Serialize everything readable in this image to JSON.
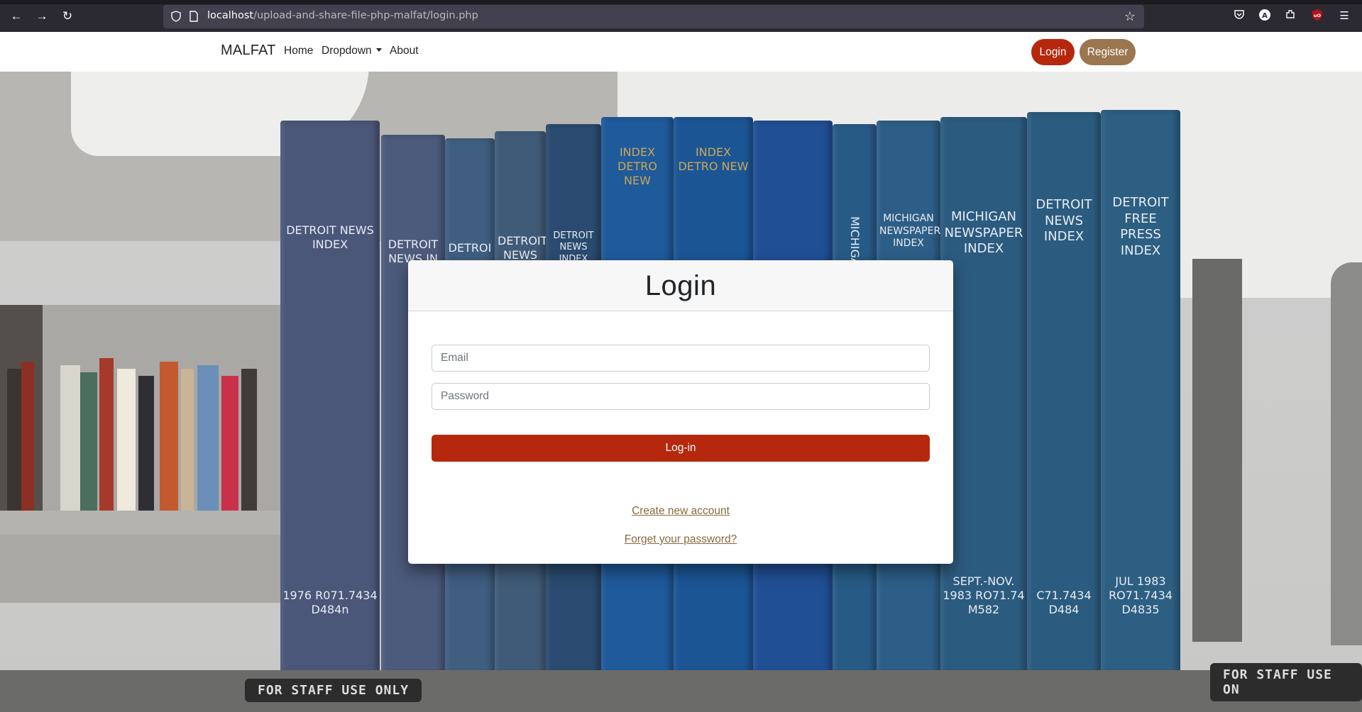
{
  "browser": {
    "url_host": "localhost",
    "url_path": "/upload-and-share-file-php-malfat/login.php"
  },
  "navbar": {
    "brand": "MALFAT",
    "links": [
      {
        "label": "Home"
      },
      {
        "label": "Dropdown"
      },
      {
        "label": "About"
      }
    ],
    "login_label": "Login",
    "register_label": "Register",
    "colors": {
      "login": "#b5280d",
      "register": "#9b7651"
    }
  },
  "login_card": {
    "title": "Login",
    "email_placeholder": "Email",
    "password_placeholder": "Password",
    "submit_label": "Log-in",
    "create_account_label": "Create new account",
    "forgot_password_label": "Forget your password?"
  },
  "background": {
    "book_spines": [
      "DETROIT NEWS INDEX",
      "DETROIT NEWS IN",
      "DETROI",
      "DETROIT NEWS",
      "DETROIT NEWS INDEX 1979",
      "INDEX DETRO NEW",
      "INDEX DETRO NEW",
      "",
      "MICHIGAN",
      "MICHIGAN NEWSPAPER INDEX",
      "MICHIGAN NEWSPAPER INDEX",
      "DETROIT NEWS INDEX",
      "DETROIT FREE PRESS INDEX"
    ],
    "spine_footers": [
      "1976 R071.7434 D484n",
      "SEPT.-NOV. 1983 RO71.74 M582",
      "C71.7434 D484",
      "JUL 1983 RO71.7434 D4835"
    ],
    "plates": [
      "FOR STAFF USE ONLY",
      "FOR STAFF USE ON"
    ]
  }
}
